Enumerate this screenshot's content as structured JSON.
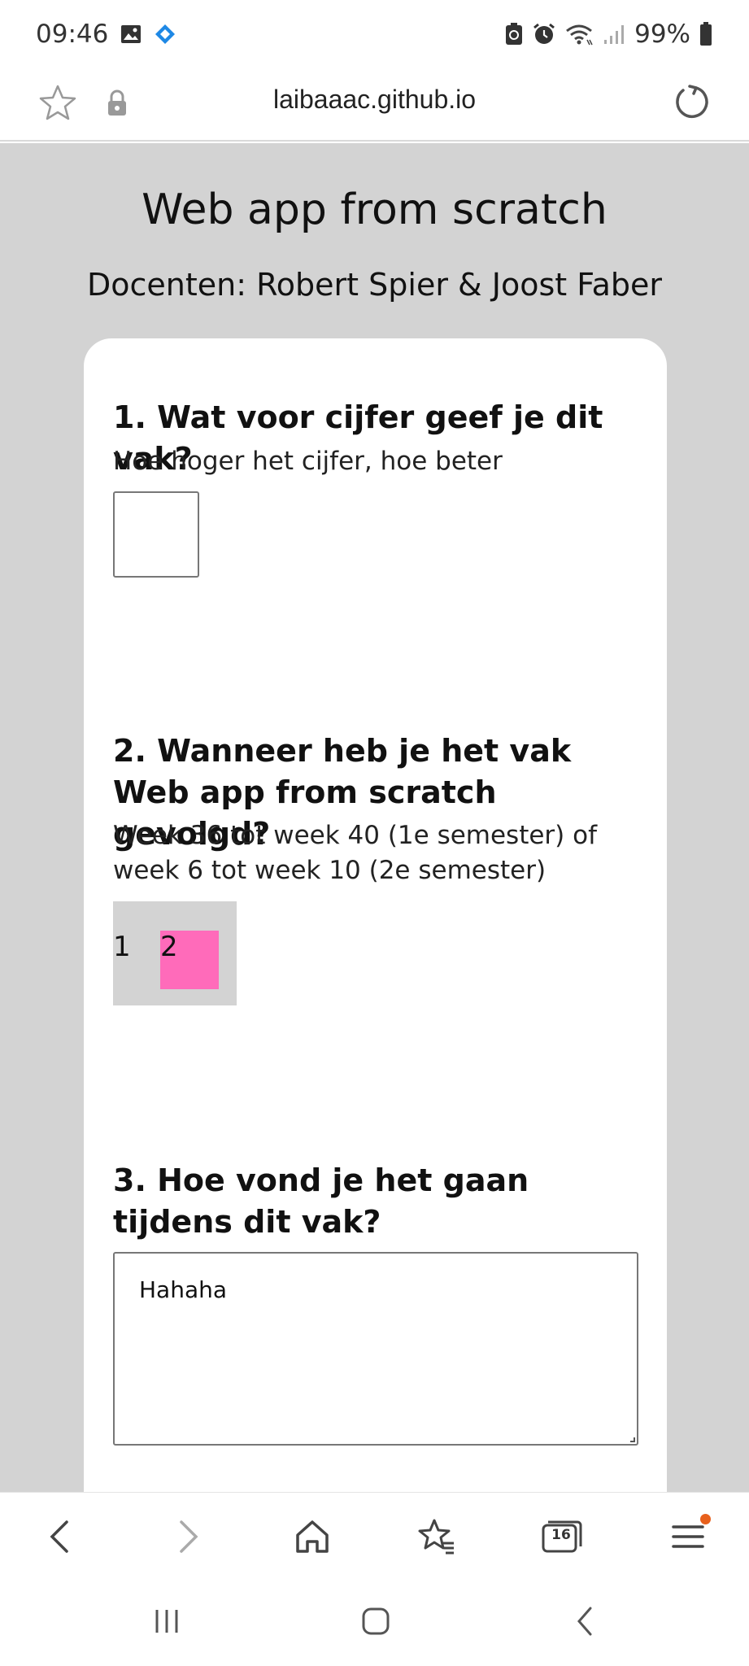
{
  "status_bar": {
    "time": "09:46",
    "battery": "99%",
    "left_icons": [
      "image-icon",
      "diamond-app-icon"
    ],
    "right_icons": [
      "battery-saver-icon",
      "alarm-icon",
      "wifi-icon",
      "signal-icon",
      "battery-icon"
    ]
  },
  "browser": {
    "url": "laibaaac.github.io"
  },
  "page": {
    "title": "Web app from scratch",
    "subtitle": "Docenten: Robert Spier & Joost Faber"
  },
  "questions": {
    "q1": {
      "title": "1. Wat voor cijfer geef je dit vak?",
      "description": "Hoe hoger het cijfer, hoe beter",
      "value": ""
    },
    "q2": {
      "title": "2. Wanneer heb je het vak Web app from scratch gevolgd?",
      "description": "Week 36 tot week 40 (1e semester) of week 6 tot week 10 (2e semester)",
      "options": [
        "1",
        "2"
      ],
      "selected": "2"
    },
    "q3": {
      "title": "3. Hoe vond je het gaan tijdens dit vak?",
      "value": "Hahaha"
    }
  },
  "toolbar": {
    "tab_count": "16"
  },
  "colors": {
    "page_background": "#d3d3d3",
    "selected_option": "#ff6bba",
    "notification_dot": "#e8601c"
  }
}
